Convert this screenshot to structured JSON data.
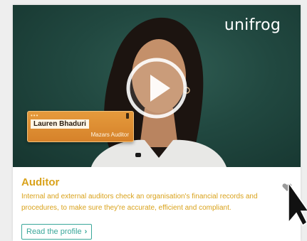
{
  "video": {
    "brand": "unifrog",
    "nametag": {
      "name": "Lauren Bhaduri",
      "role": "Mazars Auditor"
    },
    "icons": {
      "play": "play-icon",
      "dots": "dots-icon",
      "pin": "pin-icon"
    }
  },
  "profile": {
    "title": "Auditor",
    "description": "Internal and external auditors check an organisation's financial records and procedures, to make sure they're accurate, efficient and compliant.",
    "read_label": "Read the profile",
    "read_chevron": "›",
    "favorite_icon": "heart-icon"
  },
  "cursor": "arrow-cursor-icon",
  "colors": {
    "accent_gold": "#d9a21b",
    "teal": "#3aa79a",
    "video_bg": "#214840",
    "nametag": "#d6822a"
  }
}
